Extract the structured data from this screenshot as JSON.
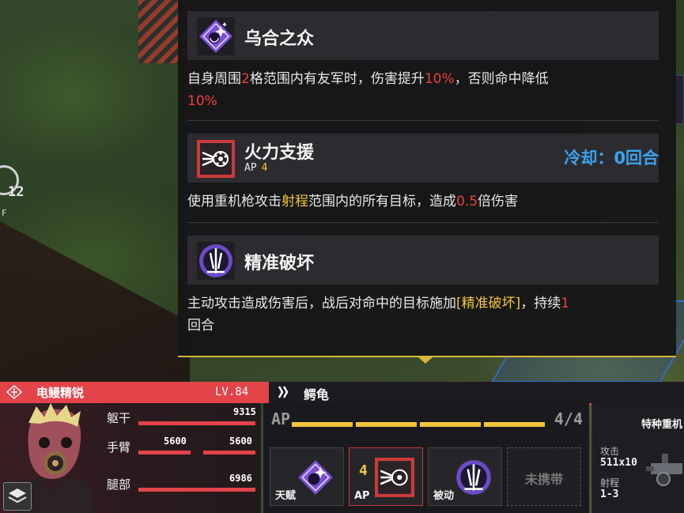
{
  "hud": {
    "clock_number": "12",
    "floor_label": "F"
  },
  "tooltip": {
    "skills": [
      {
        "title": "乌合之众",
        "icon": "crowd-sparkle-icon",
        "desc_parts": [
          "自身周围",
          "2",
          "格范围内有友军时，伤害提升",
          "10%",
          "，否则命中降低",
          "10%"
        ]
      },
      {
        "title": "火力支援",
        "icon": "heavy-machinegun-icon",
        "ap_label": "AP",
        "ap_value": "4",
        "cooldown": "冷却：0回合",
        "desc_parts": [
          "使用重机枪攻击",
          "射程",
          "范围内的所有目标，造成",
          "0.5",
          "倍伤害"
        ]
      },
      {
        "title": "精准破坏",
        "icon": "precision-strike-icon",
        "desc_parts": [
          "主动攻击造成伤害后，战后对命中的目标施加",
          "[精准破坏]",
          "，持续",
          "1",
          "回合"
        ]
      }
    ]
  },
  "unit": {
    "name": "电鳗精锐",
    "level": "LV.84",
    "mech_name": "鳄龟",
    "stats": [
      {
        "label": "躯干",
        "value": "9315"
      },
      {
        "label": "手臂",
        "left_value": "5600",
        "right_value": "5600"
      },
      {
        "label": "腿部",
        "value": "6986"
      }
    ]
  },
  "ap": {
    "label": "AP",
    "value": "4/4",
    "current": 4,
    "max": 4,
    "slots": [
      {
        "label": "天赋",
        "icon": "crowd-sparkle-icon"
      },
      {
        "label": "AP",
        "ap": "4",
        "icon": "heavy-machinegun-icon"
      },
      {
        "label": "被动",
        "icon": "precision-strike-icon"
      },
      {
        "label": "未携带",
        "empty": true
      }
    ]
  },
  "weapon": {
    "name": "特种重机",
    "attack_label": "攻击",
    "attack_value": "511x10",
    "range_label": "射程",
    "range_value": "1-3"
  },
  "colors": {
    "highlight_red": "#f0403a",
    "highlight_yellow": "#f2c53a",
    "cooldown_blue": "#3aa4f0",
    "unit_red": "#e2444a"
  }
}
